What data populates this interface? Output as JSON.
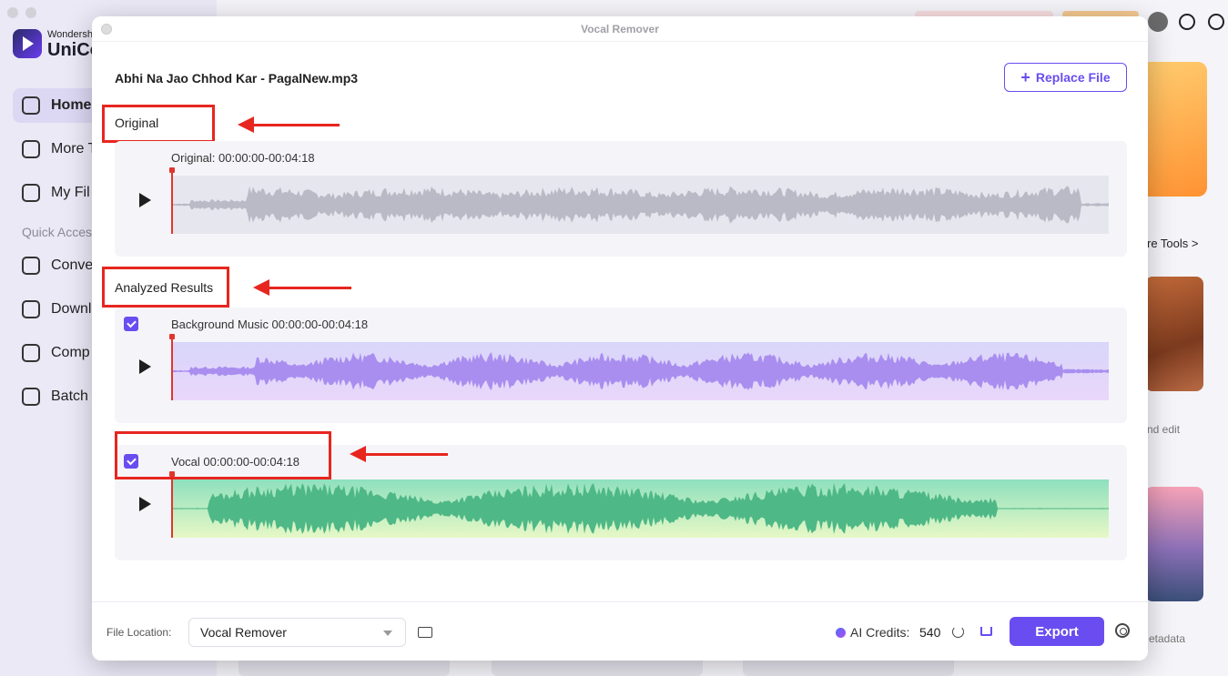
{
  "background_app": {
    "brand_small": "Wondersh",
    "brand_big": "UniCo",
    "nav": [
      {
        "label": "Home",
        "icon": "home-icon"
      },
      {
        "label": "More T",
        "icon": "toolbox-icon"
      },
      {
        "label": "My Fil",
        "icon": "file-icon"
      },
      {
        "label": "Conve",
        "icon": "convert-icon"
      },
      {
        "label": "Downl",
        "icon": "download-icon"
      },
      {
        "label": "Comp",
        "icon": "compress-icon"
      },
      {
        "label": "Batch",
        "icon": "image-icon"
      }
    ],
    "quick_access": "Quick Acces",
    "more_tools": "re Tools >",
    "nd_edit": "nd edit",
    "metadata": "etadata"
  },
  "modal": {
    "title": "Vocal Remover",
    "file_name": "Abhi Na Jao Chhod Kar - PagalNew.mp3",
    "replace_button": "Replace File",
    "original_label": "Original",
    "analyzed_label": "Analyzed Results",
    "tracks": {
      "original": {
        "caption": "Original: 00:00:00-00:04:18",
        "color": "#b9bac6",
        "checked": false
      },
      "background": {
        "caption": "Background Music 00:00:00-00:04:18",
        "color": "#a98ef0",
        "checked": true
      },
      "vocal": {
        "caption": "Vocal  00:00:00-00:04:18",
        "color": "#4eb886",
        "checked": true
      }
    },
    "footer": {
      "file_location_label": "File Location:",
      "file_location_value": "Vocal Remover",
      "ai_credits_label": "AI Credits:",
      "ai_credits_value": "540",
      "export_button": "Export"
    }
  },
  "colors": {
    "accent": "#6a4df0",
    "annotation_red": "#e7261f"
  }
}
